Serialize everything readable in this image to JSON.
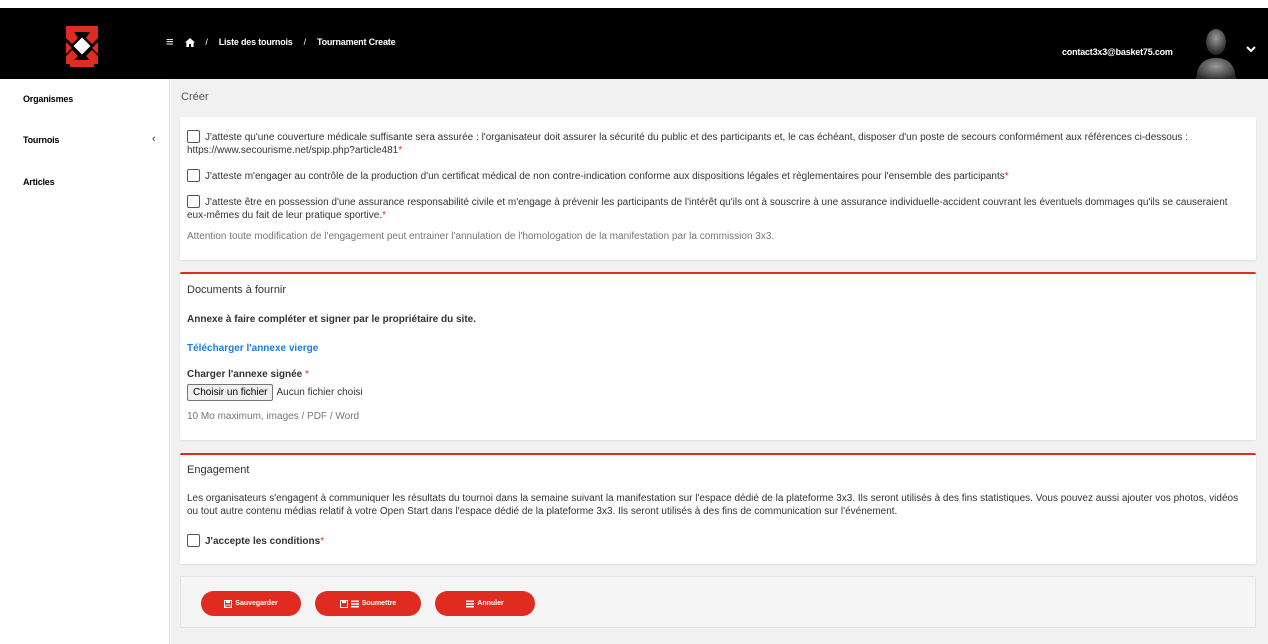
{
  "header": {
    "breadcrumb": [
      "Liste des tournois",
      "Tournament Create"
    ],
    "separator": "/",
    "user_email": "contact3x3@basket75.com",
    "icons": [
      "menu-icon",
      "home-icon",
      "chevron-down-icon"
    ]
  },
  "sidebar": {
    "items": [
      {
        "label": "Organismes"
      },
      {
        "label": "Tournois",
        "chevron": "‹"
      },
      {
        "label": "Articles"
      }
    ]
  },
  "main": {
    "title": "Créer",
    "attestations": [
      {
        "text": "J'atteste qu'une couverture médicale suffisante sera assurée : l'organisateur doit assurer la sécurité du public et des participants et, le cas échéant, disposer d'un poste de secours conformément aux références ci-dessous : https://www.secourisme.net/spip.php?article481",
        "required": "*"
      },
      {
        "text": "J'atteste m'engager au contrôle de la production d'un certificat médical de non contre-indication conforme aux dispositions légales et règlementaires pour l'ensemble des participants",
        "required": "*"
      },
      {
        "text": "J'atteste être en possession d'une assurance responsabilité civile et m'engage à prévenir les participants de l'intérêt qu'ils ont à souscrire à une assurance individuelle-accident couvrant les éventuels dommages qu'ils se causeraient eux-mêmes du fait de leur pratique sportive.",
        "required": "*"
      }
    ],
    "warning": "Attention toute modification de l'engagement peut entrainer l'annulation de l'homologation de la manifestation par la commission 3x3."
  },
  "documents": {
    "title": "Documents à fournir",
    "annex_note": "Annexe à faire compléter et signer par le propriétaire du site.",
    "download_link": "Télécharger l'annexe vierge",
    "upload_label": "Charger l'annexe signée",
    "upload_required": "*",
    "file_button": "Choisir un fichier",
    "file_status": "Aucun fichier choisi",
    "help": "10 Mo maximum, images / PDF / Word"
  },
  "engagement": {
    "title": "Engagement",
    "text": "Les organisateurs s'engagent à communiquer les résultats du tournoi dans la semaine suivant la manifestation sur l'espace dédié de la plateforme 3x3. Ils seront utilisés à des fins statistiques. Vous pouvez aussi ajouter vos photos, vidéos ou tout autre contenu médias relatif à votre Open Start dans l'espace dédié de la plateforme 3x3. Ils seront utilisés à des fins de communication sur l'événement.",
    "accept_label": "J'accepte les conditions",
    "accept_required": "*"
  },
  "actions": {
    "save": "Sauvegarder",
    "submit": "Soumettre",
    "cancel": "Annuler"
  },
  "colors": {
    "accent": "#e02b20",
    "link": "#1a7ee0",
    "topbar": "#000000"
  }
}
